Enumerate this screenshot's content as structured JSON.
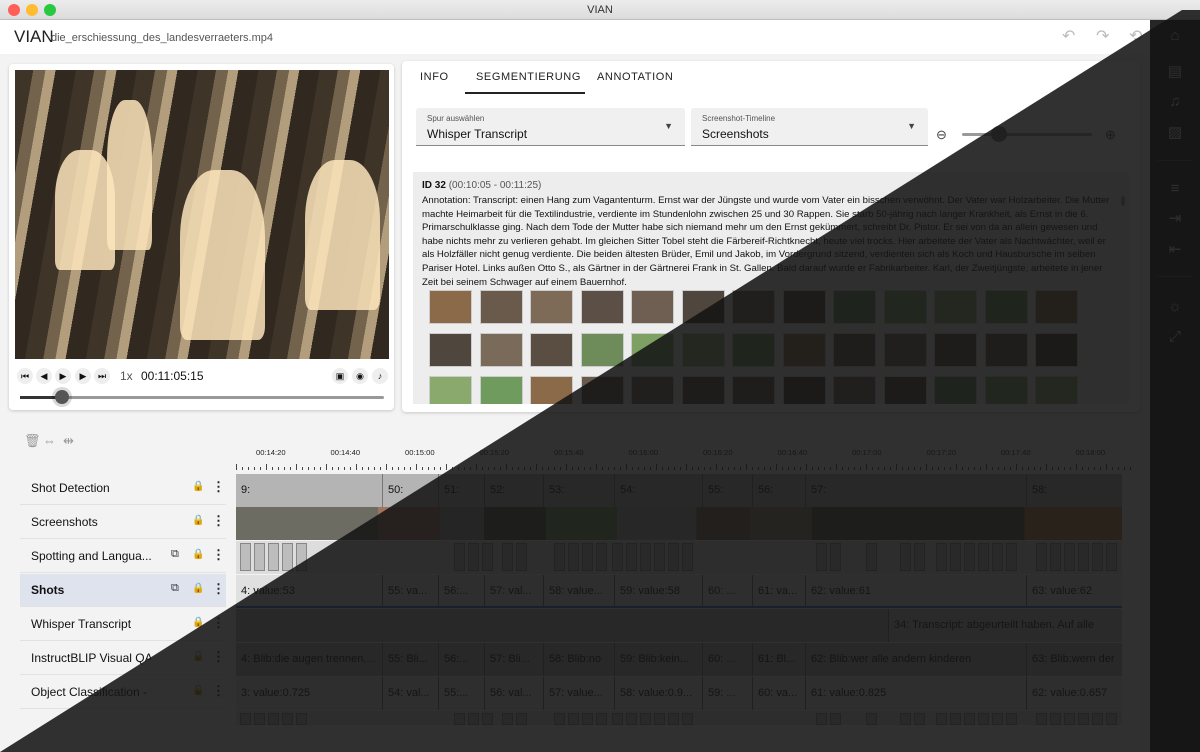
{
  "window": {
    "title": "VIAN"
  },
  "appbar": {
    "app_name": "VIAN",
    "file_name": "die_erschiessung_des_landesverraeters.mp4"
  },
  "player": {
    "speed": "1x",
    "timecode": "00:11:05:15",
    "progress": 0.115
  },
  "tabs": [
    "INFO",
    "SEGMENTIERUNG",
    "ANNOTATION"
  ],
  "selects": {
    "track": {
      "label": "Spur auswählen",
      "value": "Whisper Transcript"
    },
    "screenshot": {
      "label": "Screenshot-Timeline",
      "value": "Screenshots"
    }
  },
  "zoom_level": 0.25,
  "annotation": {
    "id": "ID 32",
    "range": "(00:10:05 - 00:11:25)",
    "text": "Annotation: Transcript: einen Hang zum Vagantenturm. Ernst war der Jüngste und wurde vom Vater ein bisschen verwöhnt. Der Vater war Holzarbeiter. Die Mutter machte Heimarbeit für die Textilindustrie, verdiente im Stundenlohn zwischen 25 und 30 Rappen. Sie starb 50-jährig nach langer Krankheit, als Ernst in die 6. Primarschulklasse ging. Nach dem Tode der Mutter habe sich niemand mehr um den Ernst gekümmert, schreibt Dr. Pistor. Er sei von da an allein gewesen und habe nichts mehr zu verlieren gehabt. Im gleichen Sitter Tobel steht die Färbereif-Richtknecht, heute viel trocks. Hier arbeitete der Vater als Nachtwächter, weil er als Holzfäller nicht genug verdiente. Die beiden ältesten Brüder, Emil und Jakob, im Vordergrund sitzend, verdienten sich als Koch und Hausbursche im selben Pariser Hotel. Links außen Otto S., als Gärtner in der Gärtnerei Frank in St. Gallen. Bald darauf wurde er Fabrikarbeiter. Karl, der Zweitjüngste, arbeitete in jener Zeit bei seinem Schwager auf einem Bauernhof."
  },
  "ruler": [
    "00:14:20",
    "00:14:40",
    "00:15:00",
    "00:15:20",
    "00:15:40",
    "00:16:00",
    "00:16:20",
    "00:16:40",
    "00:17:00",
    "00:17:20",
    "00:17:40",
    "00:18:00"
  ],
  "tracks": [
    "Shot Detection",
    "Screenshots",
    "Spotting and Langua...",
    "Shots",
    "Whisper Transcript",
    "InstructBLIP Visual QA -...",
    "Object Classification - Te..."
  ],
  "lanes": {
    "shot_detection": [
      "9:",
      "50:",
      "51:",
      "52:",
      "53:",
      "54:",
      "55:",
      "56:",
      "57:",
      "58:"
    ],
    "shots": [
      "4: value:53",
      "55: va...",
      "56:...",
      "57: val...",
      "58: value...",
      "59: value:58",
      "60: ...",
      "61: va...",
      "62: value:61",
      "63: value:62"
    ],
    "whisper": [
      "34: Transcript: abgeurteilt haben. Auf alle"
    ],
    "blip": [
      "4: Blib:die augen trennen,...",
      "55: Bli...",
      "56:...",
      "57: Bli...",
      "58: Blib:no",
      "59: Blib:kein...",
      "60: ...",
      "61: Bl...",
      "62: Blib:wer alle andern kinderen",
      "63: Blib:wern der"
    ],
    "objects": [
      "3: value:0.725",
      "54: val...",
      "55:...",
      "56: val...",
      "57: value...",
      "58: value:0.9...",
      "59: ...",
      "60: va...",
      "61: value:0.825",
      "62: value:0.657"
    ]
  },
  "icons": {
    "home": "home-icon",
    "undo": "undo-icon",
    "redo": "redo-icon",
    "history": "history-icon"
  }
}
